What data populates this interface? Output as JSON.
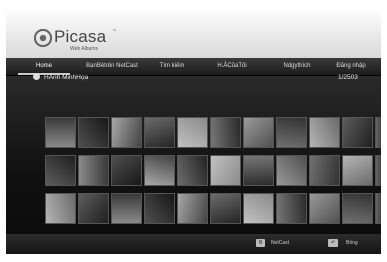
{
  "app": {
    "name": "Picasa",
    "trademark": "™",
    "subtitle": "Web Albums"
  },
  "nav": {
    "tabs": [
      {
        "label": "Home",
        "active": true
      },
      {
        "label": "BạnBètrên NetCast",
        "active": false
      },
      {
        "label": "Tìm kiếm",
        "active": false
      },
      {
        "label": "H.ẢCủaTôi",
        "active": false
      },
      {
        "label": "Ndgythích",
        "active": false
      },
      {
        "label": "Đăng nhập",
        "active": false
      }
    ]
  },
  "album": {
    "icon": "album-icon",
    "title": "HẢnh MinhHọa",
    "counter": "1/2503"
  },
  "thumbnails": {
    "count_per_row": 10,
    "rows": 3
  },
  "footer": {
    "buttons": [
      {
        "key": "B",
        "label": "NetCast"
      },
      {
        "key": "↶",
        "label": "Bồng"
      }
    ]
  },
  "colors": {
    "background": "#141414",
    "header": "#e8e8e8",
    "accent": "#c9c9c9"
  }
}
